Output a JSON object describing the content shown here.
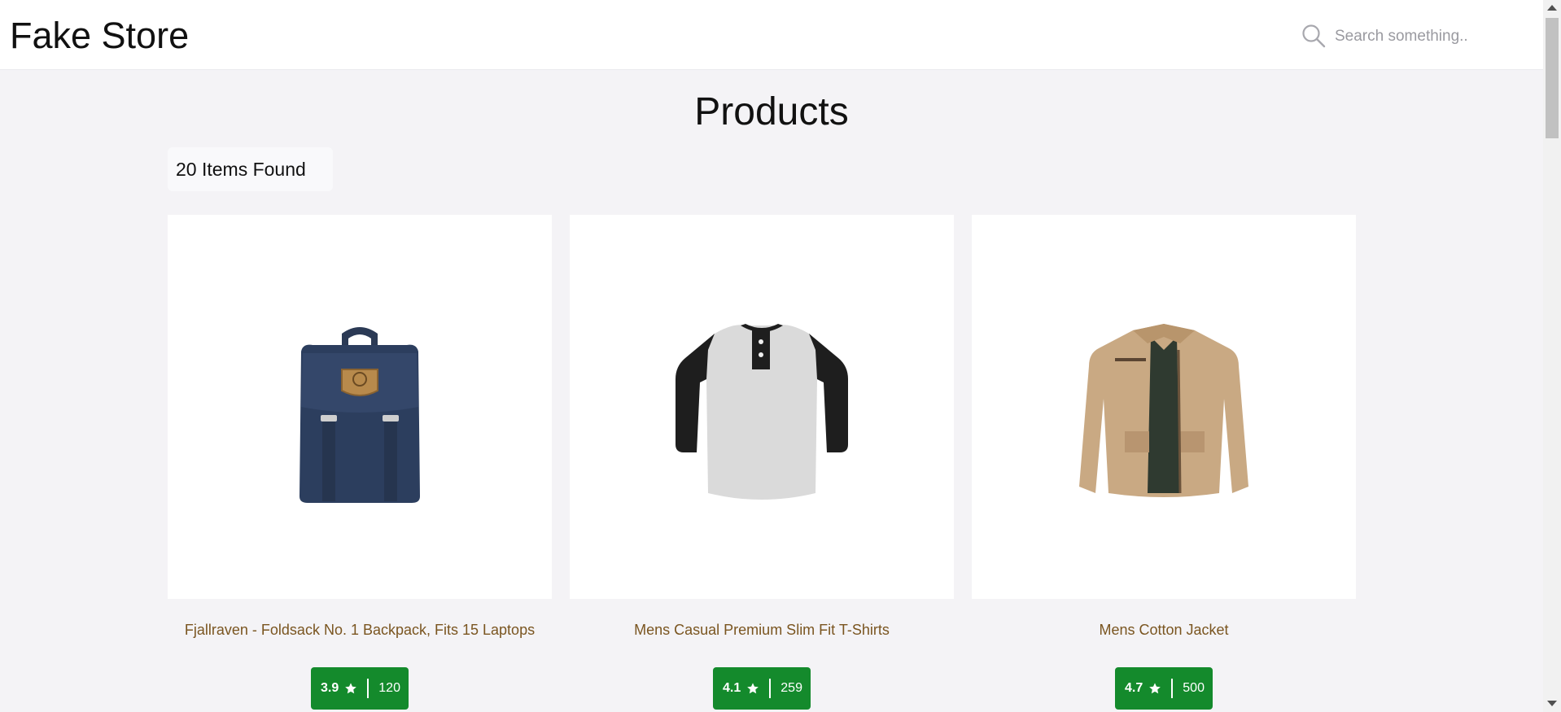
{
  "header": {
    "brand": "Fake Store",
    "search": {
      "placeholder": "Search something..",
      "value": ""
    }
  },
  "main": {
    "title": "Products",
    "count_label": "20 Items Found",
    "products": [
      {
        "title": "Fjallraven - Foldsack No. 1 Backpack, Fits 15 Laptops",
        "rating": "3.9",
        "count": "120",
        "image": "backpack"
      },
      {
        "title": "Mens Casual Premium Slim Fit T-Shirts",
        "rating": "4.1",
        "count": "259",
        "image": "tshirt"
      },
      {
        "title": "Mens Cotton Jacket",
        "rating": "4.7",
        "count": "500",
        "image": "jacket"
      }
    ]
  },
  "colors": {
    "rating_badge": "#148a2c",
    "product_title": "#7a5520",
    "background": "#f4f3f6"
  }
}
